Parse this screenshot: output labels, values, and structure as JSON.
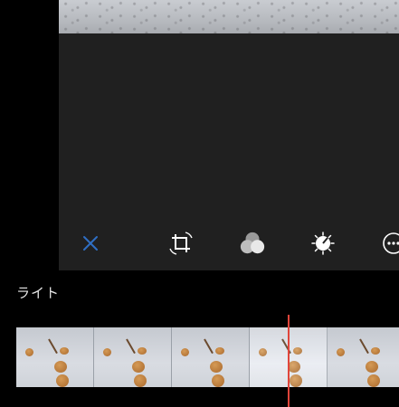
{
  "section_label": "ライト",
  "toolbar": {
    "items": [
      {
        "name": "close-icon",
        "color": "#2f6fc4"
      },
      {
        "name": "crop-rotate-icon",
        "color": "#ffffff"
      },
      {
        "name": "filters-icon",
        "color": "#ffffff"
      },
      {
        "name": "adjust-light-icon",
        "color": "#ffffff"
      },
      {
        "name": "more-options-icon",
        "color": "#ffffff"
      }
    ]
  },
  "filmstrip": {
    "frame_count": 5,
    "selected_index": 3
  },
  "colors": {
    "playhead": "#e0453b",
    "background": "#000000",
    "panel": "#202020"
  }
}
